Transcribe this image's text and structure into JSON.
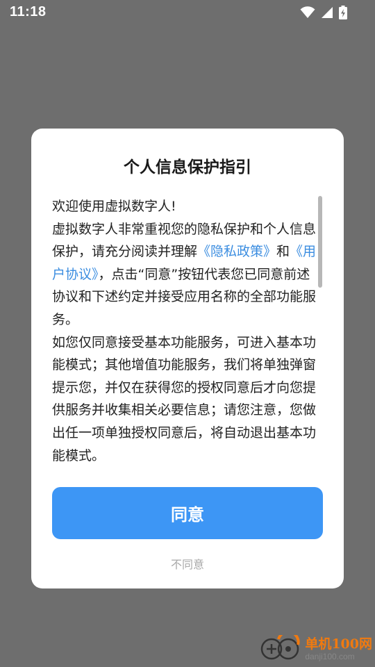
{
  "status_bar": {
    "time": "11:18",
    "icons": [
      "wifi-icon",
      "cellular-signal-icon",
      "battery-charging-icon"
    ]
  },
  "dialog": {
    "title": "个人信息保护指引",
    "paragraphs": {
      "welcome": "欢迎使用虚拟数字人!",
      "p2_text1": "虚拟数字人非常重视您的隐私保护和个人信息保护，请充分阅读并理解",
      "privacy_policy_link": "《隐私政策》",
      "p2_and": "和",
      "user_agreement_link": "《用户协议》",
      "p2_text2": "，点击“同意”按钮代表您已同意前述协议和下述约定并接受应用名称的全部功能服务。",
      "p3": "如您仅同意接受基本功能服务，可进入基本功能模式；其他增值功能服务，我们将单独弹窗提示您，并仅在获得您的授权同意后才向您提供服务并收集相关必要信息；请您注意，您做出任一项单独授权同意后，将自动退出基本功能模式。"
    },
    "agree_label": "同意",
    "disagree_label": "不同意"
  },
  "watermark": {
    "text_cn": "单机100网",
    "text_en": "danji100.com"
  },
  "colors": {
    "accent": "#3d96f5",
    "link": "#3b8de0",
    "overlay": "#6e6e6e",
    "watermark_orange": "#f07a10"
  }
}
